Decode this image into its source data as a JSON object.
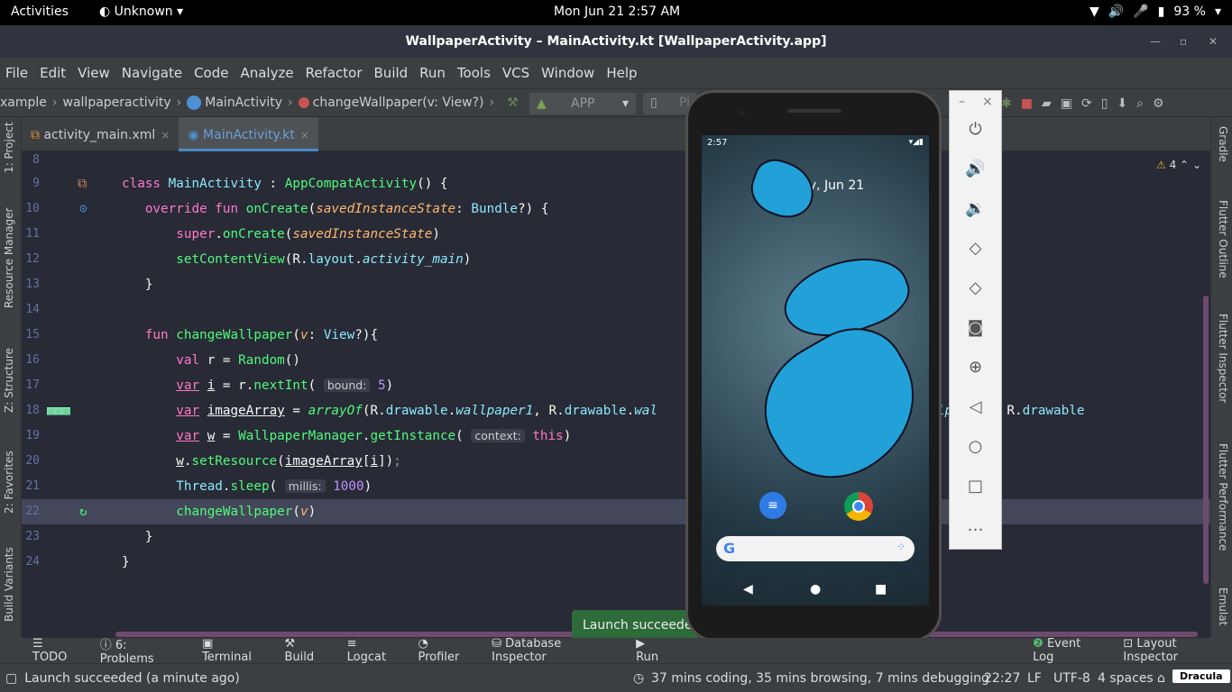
{
  "topbar": {
    "activities": "Activities",
    "app": "Unknown",
    "clock": "Mon Jun 21   2:57 AM",
    "battery": "93 %"
  },
  "window": {
    "title": "WallpaperActivity – MainActivity.kt [WallpaperActivity.app]"
  },
  "menu": [
    "File",
    "Edit",
    "View",
    "Navigate",
    "Code",
    "Analyze",
    "Refactor",
    "Build",
    "Run",
    "Tools",
    "VCS",
    "Window",
    "Help"
  ],
  "breadcrumb": {
    "c1": "xample",
    "c2": "wallpaperactivity",
    "c3": "MainActivity",
    "c4": "changeWallpaper(v: View?)"
  },
  "runconfig": "APP",
  "devconfig": "Pi",
  "tabs": {
    "t1": "activity_main.xml",
    "t2": "MainActivity.kt",
    "x": "×"
  },
  "left_tools": {
    "project": "1: Project",
    "resource": "Resource Manager",
    "structure": "Z: Structure",
    "favorites": "2: Favorites",
    "variants": "Build Variants"
  },
  "right_tools": {
    "gradle": "Gradle",
    "outline": "Flutter Outline",
    "inspector": "Flutter Inspector",
    "performance": "Flutter Performance",
    "emulator": "Emulat"
  },
  "warnings": "4",
  "code": {
    "l8": "8",
    "l9": "9",
    "l10": "10",
    "l11": "11",
    "l12": "12",
    "l13": "13",
    "l14": "14",
    "l15": "15",
    "l16": "16",
    "l17": "17",
    "l18": "18",
    "l19": "19",
    "l20": "20",
    "l21": "21",
    "l22": "22",
    "l23": "23",
    "l24": "24",
    "hint_bound": "bound:",
    "hint_context": "context:",
    "hint_millis": "millis:"
  },
  "bottom_tools": [
    "TODO",
    "6: Problems",
    "Terminal",
    "Build",
    "Logcat",
    "Profiler",
    "Database Inspector",
    "Run",
    "Event Log",
    "Layout Inspector"
  ],
  "toast": "Launch succeeded",
  "status": {
    "message": "Launch succeeded (a minute ago)",
    "activity": "37 mins coding, 35 mins browsing, 7 mins debugging",
    "position": "22:27",
    "eol": "LF",
    "encoding": "UTF-8",
    "indent": "4 spaces",
    "theme": "Dracula"
  },
  "phone": {
    "time": "2:57",
    "date": "Monday, Jun 21"
  }
}
